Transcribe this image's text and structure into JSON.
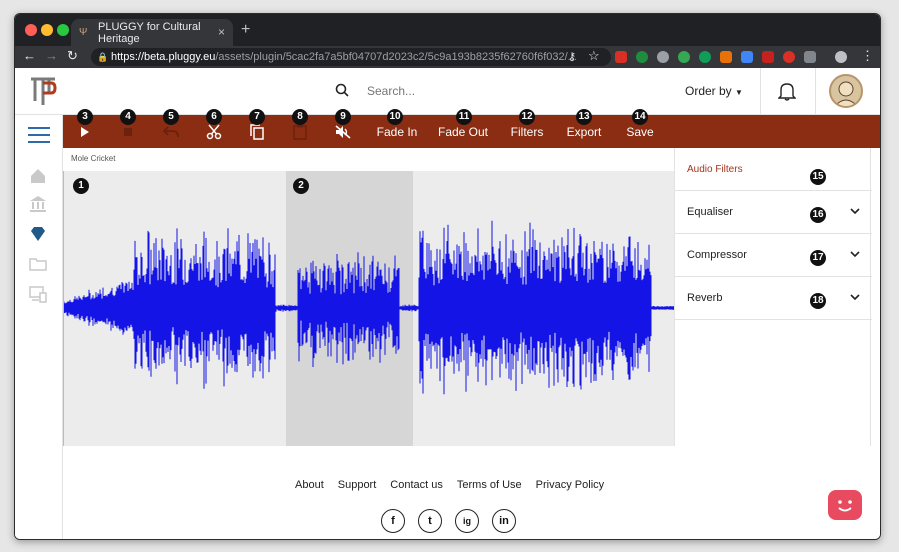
{
  "browser": {
    "tab_title": "PLUGGY for Cultural Heritage",
    "tab_close": "×",
    "new_tab": "+",
    "url_host": "https://beta.pluggy.eu",
    "url_path": "/assets/plugin/5cac2fa7a5bf04707d2023c2/5c9a193b8235f62760f6f032/..."
  },
  "header": {
    "search_placeholder": "Search...",
    "order_by": "Order by"
  },
  "editor": {
    "toolbar": {
      "fade_in": "Fade In",
      "fade_out": "Fade Out",
      "filters": "Filters",
      "export": "Export",
      "save": "Save"
    },
    "track_title": "Mole Cricket",
    "badges": [
      "1",
      "2",
      "3",
      "4",
      "5",
      "6",
      "7",
      "8",
      "9",
      "10",
      "11",
      "12",
      "13",
      "14",
      "15",
      "16",
      "17",
      "18"
    ]
  },
  "filters_panel": {
    "heading": "Audio Filters",
    "items": [
      {
        "label": "Equaliser"
      },
      {
        "label": "Compressor"
      },
      {
        "label": "Reverb"
      }
    ]
  },
  "footer": {
    "links": [
      "About",
      "Support",
      "Contact us",
      "Terms of Use",
      "Privacy Policy"
    ],
    "social": [
      "f",
      "t",
      "ig",
      "in"
    ]
  },
  "colors": {
    "toolbar_bg": "#8a2d12",
    "wave": "#1414e6",
    "accent_red": "#a8321c",
    "chat": "#e84a5f"
  }
}
